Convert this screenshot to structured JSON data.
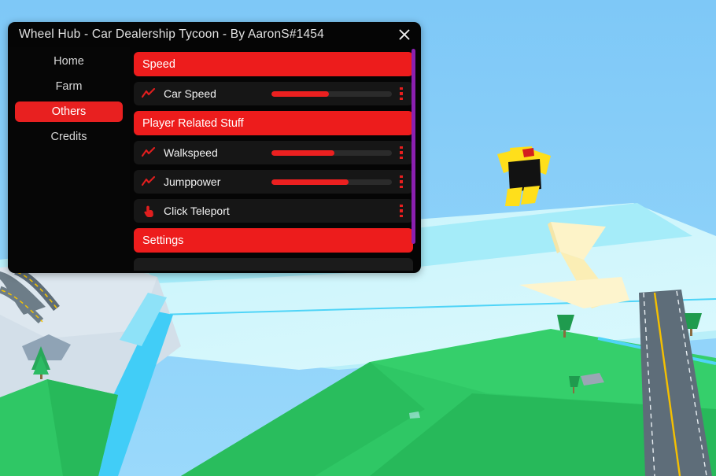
{
  "window": {
    "title": "Wheel Hub - Car Dealership Tycoon - By AaronS#1454",
    "close_icon": "close-icon"
  },
  "sidebar": {
    "items": [
      {
        "label": "Home",
        "active": false
      },
      {
        "label": "Farm",
        "active": false
      },
      {
        "label": "Others",
        "active": true
      },
      {
        "label": "Credits",
        "active": false
      }
    ]
  },
  "content": {
    "sections": [
      {
        "type": "header",
        "label": "Speed"
      },
      {
        "type": "item",
        "label": "Car Speed",
        "icon": "trending-up-icon",
        "slider": true,
        "value_percent": 48,
        "menu_icon": "kebab-menu-icon"
      },
      {
        "type": "header",
        "label": "Player Related Stuff"
      },
      {
        "type": "item",
        "label": "Walkspeed",
        "icon": "trending-up-icon",
        "slider": true,
        "value_percent": 52,
        "menu_icon": "kebab-menu-icon"
      },
      {
        "type": "item",
        "label": "Jumppower",
        "icon": "trending-up-icon",
        "slider": true,
        "value_percent": 64,
        "menu_icon": "kebab-menu-icon"
      },
      {
        "type": "item",
        "label": "Click Teleport",
        "icon": "pointing-hand-icon",
        "slider": false,
        "menu_icon": "kebab-menu-icon"
      },
      {
        "type": "header",
        "label": "Settings"
      }
    ],
    "scrollbar": {
      "name": "vertical-scrollbar"
    }
  },
  "colors": {
    "accent_red": "#ed1c1c",
    "panel_bg": "#050505",
    "row_bg": "#161616",
    "scrollbar_purple": "#8b1fb0",
    "text": "#e2e2e2",
    "sky": "#7ecbf7",
    "grass": "#2fc762",
    "snow": "#d6e1ea",
    "water": "#35c6f4",
    "road": "#5b6a75",
    "road_line": "#f5c000",
    "character_limb": "#ffdf1b",
    "character_torso": "#121212"
  },
  "game": {
    "scene": "roblox-car-dealership-tycoon",
    "character": "avatar-midair"
  }
}
